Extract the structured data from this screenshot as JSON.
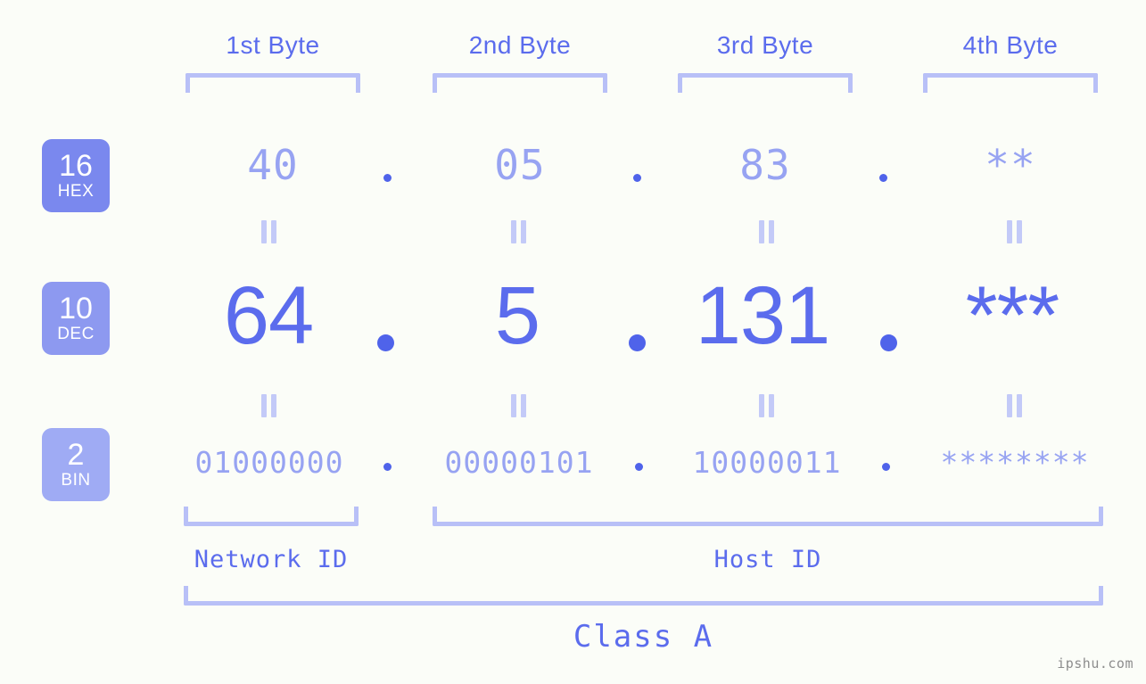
{
  "watermark": "ipshu.com",
  "colors": {
    "background": "#fbfdf8",
    "accent": "#5b6ced",
    "accent_light": "#97a3f2",
    "bracket": "#b8c0f7",
    "badge_hex": "#7a88ee",
    "badge_dec": "#8d99f0",
    "badge_bin": "#9fabf4",
    "dot": "#4f63ea",
    "watermark_text": "#8d8d8d"
  },
  "byte_headers": [
    {
      "label": "1st Byte"
    },
    {
      "label": "2nd Byte"
    },
    {
      "label": "3rd Byte"
    },
    {
      "label": "4th Byte"
    }
  ],
  "bases": [
    {
      "number": "16",
      "name": "HEX"
    },
    {
      "number": "10",
      "name": "DEC"
    },
    {
      "number": "2",
      "name": "BIN"
    }
  ],
  "rows": {
    "hex": {
      "values": [
        "40",
        "05",
        "83",
        "**"
      ]
    },
    "dec": {
      "values": [
        "64",
        "5",
        "131",
        "***"
      ]
    },
    "bin": {
      "values": [
        "01000000",
        "00000101",
        "10000011",
        "********"
      ]
    }
  },
  "separators": {
    "hex": [
      ".",
      ".",
      "."
    ],
    "dec": [
      ".",
      ".",
      "."
    ],
    "bin": [
      ".",
      ".",
      "."
    ]
  },
  "equals_marks": {
    "symbol": "‖",
    "count_per_row": 4
  },
  "segments": [
    {
      "label": "Network ID"
    },
    {
      "label": "Host ID"
    }
  ],
  "ip_class": {
    "label": "Class A"
  }
}
